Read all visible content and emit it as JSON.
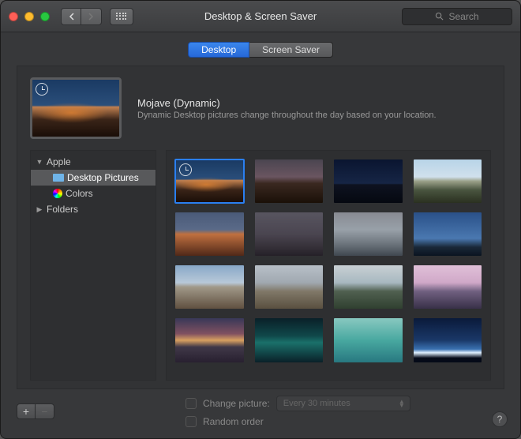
{
  "window": {
    "title": "Desktop & Screen Saver"
  },
  "search": {
    "placeholder": "Search"
  },
  "tabs": [
    {
      "label": "Desktop",
      "active": true
    },
    {
      "label": "Screen Saver",
      "active": false
    }
  ],
  "selected_wallpaper": {
    "title": "Mojave (Dynamic)",
    "description": "Dynamic Desktop pictures change throughout the day based on your location.",
    "style": "mojave-day",
    "dynamic": true
  },
  "sidebar": {
    "apple_label": "Apple",
    "desktop_pictures_label": "Desktop Pictures",
    "colors_label": "Colors",
    "folders_label": "Folders"
  },
  "wallpapers": [
    {
      "style": "mojave-day",
      "dynamic": true,
      "selected": true
    },
    {
      "style": "mojave-dusk"
    },
    {
      "style": "mojave-night"
    },
    {
      "style": "sierra"
    },
    {
      "style": "mountains-orange"
    },
    {
      "style": "yosemite-dark"
    },
    {
      "style": "yosemite-fog"
    },
    {
      "style": "blue-sky"
    },
    {
      "style": "yosemite-day"
    },
    {
      "style": "halfdome"
    },
    {
      "style": "pine"
    },
    {
      "style": "pink-peak"
    },
    {
      "style": "sunset-lake"
    },
    {
      "style": "aurora"
    },
    {
      "style": "wave"
    },
    {
      "style": "earth"
    }
  ],
  "options": {
    "change_picture_label": "Change picture:",
    "change_interval": "Every 30 minutes",
    "random_order_label": "Random order"
  },
  "help_label": "?"
}
